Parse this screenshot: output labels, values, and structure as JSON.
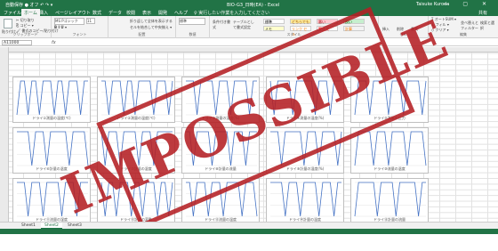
{
  "titlebar": {
    "qat": "自動保存 ● オフ  ↶ ↷ ▾",
    "title": "BIO-G3_日時(EA) - Excel",
    "user": "Taisuke Kuroda",
    "controls": "— ▢ ✕"
  },
  "tabs": [
    {
      "label": "ファイル"
    },
    {
      "label": "ホーム"
    },
    {
      "label": "挿入"
    },
    {
      "label": "ページレイアウト"
    },
    {
      "label": "数式"
    },
    {
      "label": "データ"
    },
    {
      "label": "校閲"
    },
    {
      "label": "表示"
    },
    {
      "label": "開発"
    },
    {
      "label": "ヘルプ"
    },
    {
      "label": "♀ 実行したい作業を入力してください"
    },
    {
      "label": "共有"
    }
  ],
  "ribbon": {
    "clipboard": {
      "label": "クリップボード",
      "paste": "貼り付け",
      "items": [
        "✂ 切り取り",
        "⎘ コピー ▾",
        "🖌 書式のコピー/貼り付け"
      ]
    },
    "font": {
      "label": "フォント",
      "name": "MS Pゴシック",
      "size": "11",
      "styles": "B I U ▾"
    },
    "align": {
      "label": "配置",
      "wrap": "折り返して全体を表示する",
      "merge": "セルを結合して中央揃え ▾"
    },
    "number": {
      "label": "数値",
      "format": "標準"
    },
    "styles": {
      "label": "スタイル",
      "cond": "条件付き書式",
      "table": "テーブルとして書式設定",
      "cells": [
        {
          "text": "標準",
          "bg": "#ffffff",
          "fg": "#000000"
        },
        {
          "text": "どちらでもない",
          "bg": "#ffeb9c",
          "fg": "#9c5700"
        },
        {
          "text": "悪い",
          "bg": "#ffc7ce",
          "fg": "#9c0006"
        },
        {
          "text": "良い",
          "bg": "#c6efce",
          "fg": "#006100"
        },
        {
          "text": "メモ",
          "bg": "#ffffcc",
          "fg": "#333333"
        },
        {
          "text": "リンク セル",
          "bg": "#ffffff",
          "fg": "#fa7d00"
        },
        {
          "text": "警告文",
          "bg": "#ffffff",
          "fg": "#ff0000"
        },
        {
          "text": "計算",
          "bg": "#f2f2f2",
          "fg": "#fa7d00"
        }
      ]
    },
    "cells": {
      "label": "セル",
      "insert": "挿入",
      "delete": "削除",
      "format": "書式"
    },
    "edit": {
      "label": "編集",
      "sum": "Σ オートSUM ▾",
      "fill": "↓ フィル ▾",
      "clear": "◇ クリア ▾",
      "sort": "並べ替えとフィルター",
      "find": "検索と選択"
    }
  },
  "formula_bar": {
    "name_box": "A11000",
    "fx": "fx"
  },
  "sheets": [
    {
      "label": "Sheet1"
    },
    {
      "label": "Sheet2"
    },
    {
      "label": "Sheet3"
    }
  ],
  "stamp": {
    "text": "IMPOSSIBLE",
    "color": "#b51f24"
  },
  "accent": "#217346",
  "chart_data": [
    {
      "type": "line",
      "title": "ドライ①測量の温度(℃)",
      "y": [
        0,
        9,
        9,
        0,
        9,
        9,
        0,
        9,
        9,
        9,
        0,
        9,
        9,
        0,
        9,
        9,
        9,
        0,
        9,
        9
      ]
    },
    {
      "type": "line",
      "title": "ドライ②測量の温度(℃)",
      "y": [
        9,
        9,
        0,
        9,
        9,
        9,
        0,
        9,
        9,
        0,
        9,
        9,
        9,
        9,
        0,
        9,
        9,
        9,
        0,
        9
      ]
    },
    {
      "type": "line",
      "title": "ドライ③測量の湿度(%)",
      "y": [
        9,
        9,
        9,
        0,
        9,
        9,
        9,
        9,
        0,
        9,
        9,
        9,
        0,
        9,
        9,
        9,
        9,
        0,
        9,
        9
      ]
    },
    {
      "type": "line",
      "title": "ドライ④測量の湿度(%)",
      "y": [
        9,
        0,
        9,
        9,
        9,
        9,
        0,
        9,
        9,
        9,
        9,
        9,
        0,
        9,
        9,
        9,
        0,
        9,
        9,
        9
      ]
    },
    {
      "type": "line",
      "title": "ドライ⑤測量の圧力",
      "y": [
        0,
        9,
        9,
        9,
        0,
        9,
        9,
        9,
        9,
        0,
        9,
        9,
        9,
        0,
        9,
        9,
        9,
        9,
        0,
        9
      ]
    },
    {
      "type": "line",
      "title": "ドライ⑥計量の温度",
      "y": [
        9,
        9,
        9,
        9,
        0,
        9,
        9,
        9,
        0,
        9,
        9,
        9,
        9,
        9,
        0,
        9,
        9,
        9,
        9,
        0
      ]
    },
    {
      "type": "line",
      "title": "ドライ⑦計量の湿度",
      "y": [
        9,
        0,
        9,
        9,
        9,
        0,
        9,
        9,
        9,
        9,
        0,
        9,
        9,
        9,
        0,
        9,
        9,
        9,
        9,
        9
      ]
    },
    {
      "type": "line",
      "title": "ドライ⑧計量の流量",
      "y": [
        9,
        9,
        0,
        9,
        9,
        9,
        9,
        0,
        9,
        9,
        9,
        9,
        0,
        9,
        9,
        9,
        0,
        9,
        9,
        9
      ]
    },
    {
      "type": "line",
      "title": "ドライ⑨計量の湿度(%)",
      "y": [
        9,
        9,
        9,
        0,
        9,
        9,
        9,
        9,
        9,
        0,
        9,
        9,
        9,
        0,
        9,
        9,
        9,
        9,
        0,
        9
      ]
    },
    {
      "type": "line",
      "title": "ドライ⑩流量の温度",
      "y": [
        0,
        9,
        9,
        9,
        9,
        0,
        9,
        9,
        9,
        0,
        9,
        9,
        9,
        9,
        0,
        9,
        9,
        9,
        9,
        0
      ]
    },
    {
      "type": "line",
      "title": "ドライ⑪流量の湿度",
      "y": [
        9,
        9,
        9,
        0,
        9,
        9,
        9,
        0,
        9,
        9,
        9,
        9,
        0,
        9,
        9,
        9,
        0,
        9,
        9,
        9
      ]
    },
    {
      "type": "line",
      "title": "ドライ⑫計量の変動",
      "y": [
        9,
        0,
        9,
        9,
        0,
        9,
        9,
        9,
        0,
        9,
        9,
        0,
        9,
        9,
        9,
        0,
        9,
        9,
        0,
        9
      ]
    },
    {
      "type": "line",
      "title": "ドライ⑬流量の温度",
      "y": [
        9,
        9,
        0,
        9,
        9,
        9,
        0,
        9,
        9,
        9,
        0,
        9,
        9,
        9,
        9,
        0,
        9,
        9,
        9,
        0
      ]
    },
    {
      "type": "line",
      "title": "ドライ⑭計量の温度",
      "y": [
        9,
        9,
        9,
        9,
        0,
        9,
        9,
        9,
        0,
        9,
        9,
        9,
        9,
        0,
        9,
        9,
        9,
        0,
        9,
        9
      ]
    },
    {
      "type": "line",
      "title": "ドライ⑮計量の流量",
      "y": [
        0,
        9,
        9,
        9,
        9,
        9,
        0,
        9,
        9,
        9,
        9,
        0,
        9,
        9,
        9,
        9,
        9,
        0,
        9,
        9
      ]
    }
  ]
}
